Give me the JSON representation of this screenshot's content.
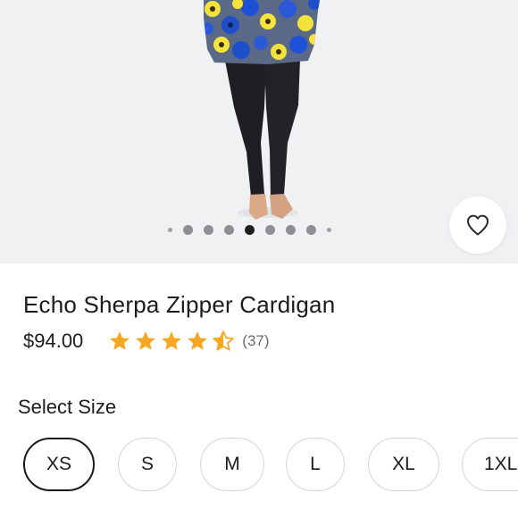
{
  "product": {
    "title": "Echo Sherpa Zipper Cardigan",
    "price": "$94.00",
    "rating": 4.5,
    "rating_max": 5,
    "review_count": "(37)",
    "star_color": "#f5a623"
  },
  "gallery": {
    "dot_count": 9,
    "active_index": 4,
    "favorite_icon": "heart-outline-icon"
  },
  "size_selector": {
    "heading": "Select Size",
    "selected": "XS",
    "options": [
      {
        "label": "XS"
      },
      {
        "label": "S"
      },
      {
        "label": "M"
      },
      {
        "label": "L"
      },
      {
        "label": "XL"
      },
      {
        "label": "1XL"
      }
    ]
  }
}
